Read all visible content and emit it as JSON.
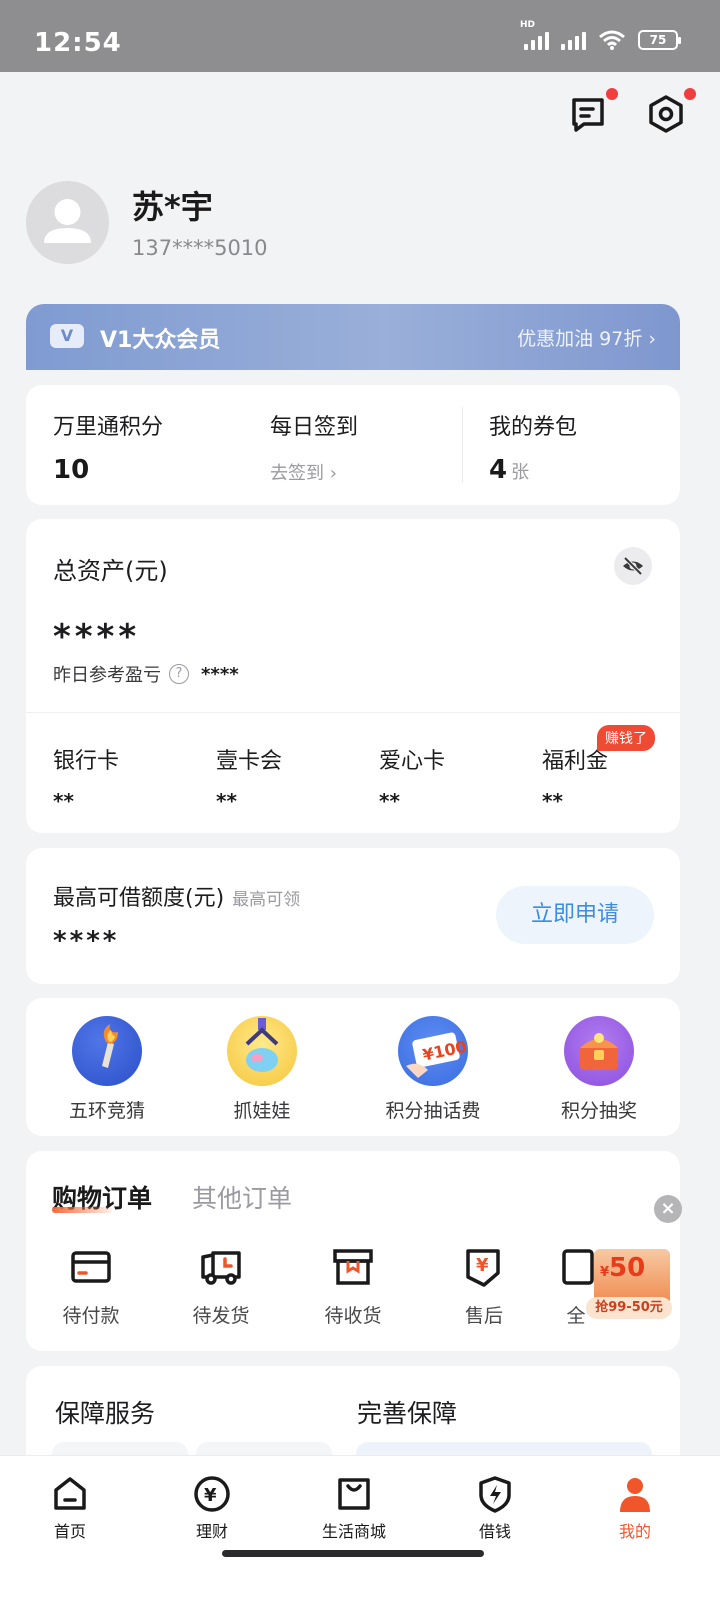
{
  "status_bar": {
    "time": "12:54",
    "battery": "75",
    "network": "HD"
  },
  "profile": {
    "name": "苏*宇",
    "phone": "137****5010"
  },
  "vip": {
    "level": "V1大众会员",
    "badge": "V",
    "promo": "优惠加油 97折 ›"
  },
  "points": {
    "points_label": "万里通积分",
    "points_value": "10",
    "checkin_label": "每日签到",
    "checkin_link": "去签到 ›",
    "coupons_label": "我的券包",
    "coupons_value": "4",
    "coupons_unit": "张"
  },
  "assets": {
    "title": "总资产(元)",
    "value": "****",
    "yesterday_label": "昨日参考盈亏",
    "yesterday_hint": "?",
    "yesterday_value": "****",
    "items": [
      {
        "label": "银行卡",
        "value": "**"
      },
      {
        "label": "壹卡会",
        "value": "**"
      },
      {
        "label": "爱心卡",
        "value": "**"
      },
      {
        "label": "福利金",
        "value": "**"
      }
    ],
    "earn_tag": "赚钱了"
  },
  "loan": {
    "title": "最高可借额度(元)",
    "subtitle": "最高可领",
    "value": "****",
    "apply_label": "立即申请"
  },
  "activities": [
    {
      "label": "五环竞猜",
      "icon": "torch-icon"
    },
    {
      "label": "抓娃娃",
      "icon": "claw-machine-icon"
    },
    {
      "label": "积分抽话费",
      "icon": "phone-credit-icon",
      "badge": "¥100"
    },
    {
      "label": "积分抽奖",
      "icon": "treasure-chest-icon"
    }
  ],
  "orders": {
    "tab_shopping": "购物订单",
    "tab_other": "其他订单",
    "close": "×",
    "items": [
      {
        "label": "待付款",
        "icon": "wallet-icon"
      },
      {
        "label": "待发货",
        "icon": "truck-icon"
      },
      {
        "label": "待收货",
        "icon": "box-icon"
      },
      {
        "label": "售后",
        "icon": "after-sales-icon"
      },
      {
        "label": "全",
        "icon": "all-orders-icon"
      }
    ],
    "coupon": {
      "currency": "¥",
      "amount": "50",
      "text": "抢99-50元"
    }
  },
  "protection": {
    "title_left": "保障服务",
    "title_right": "完善保障"
  },
  "nav": [
    {
      "label": "首页",
      "icon": "home-icon"
    },
    {
      "label": "理财",
      "icon": "finance-icon"
    },
    {
      "label": "生活商城",
      "icon": "shop-icon"
    },
    {
      "label": "借钱",
      "icon": "loan-icon"
    },
    {
      "label": "我的",
      "icon": "profile-icon",
      "active": true
    }
  ],
  "colors": {
    "accent": "#f0562a",
    "vip": "#8aa3d6",
    "link": "#3b8de0"
  }
}
